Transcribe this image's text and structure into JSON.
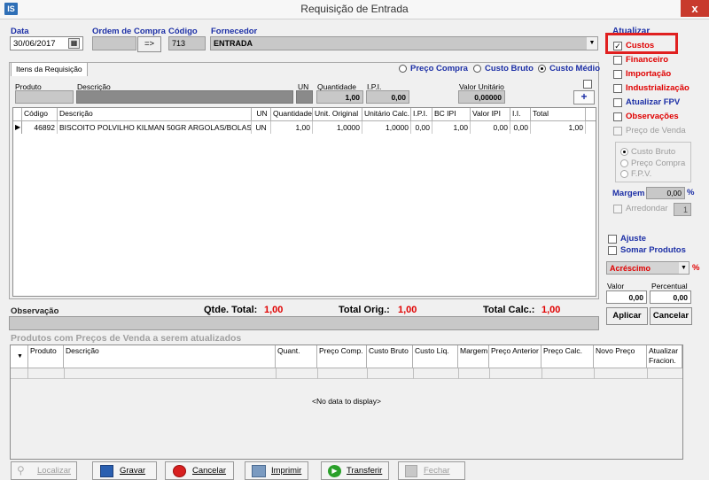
{
  "window": {
    "title": "Requisição de Entrada",
    "app_icon": "IS",
    "close": "x"
  },
  "header": {
    "data_label": "Data",
    "data_value": "30/06/2017",
    "ordem_label": "Ordem de Compra",
    "ordem_value": "",
    "ordem_btn": "=>",
    "codigo_label": "Código",
    "codigo_value": "713",
    "fornecedor_label": "Fornecedor",
    "fornecedor_value": "ENTRADA"
  },
  "tab": {
    "label": "Itens da Requisição"
  },
  "price_mode": {
    "options": [
      "Preço Compra",
      "Custo Bruto",
      "Custo Médio"
    ],
    "selected": "Custo Médio"
  },
  "item_entry": {
    "produto_label": "Produto",
    "descricao_label": "Descrição",
    "un_label": "UN",
    "quantidade_label": "Quantidade",
    "quantidade_value": "1,00",
    "ipi_label": "I.P.I.",
    "ipi_value": "0,00",
    "valor_label": "Valor Unitário",
    "valor_value": "0,00000",
    "add_btn": "+"
  },
  "items_table": {
    "columns": [
      "Código",
      "Descrição",
      "UN",
      "Quantidade",
      "Unit. Original",
      "Unitário Calc.",
      "I.P.I.",
      "BC IPI",
      "Valor IPI",
      "I.I.",
      "Total"
    ],
    "rows": [
      [
        "46892",
        "BISCOITO POLVILHO KILMAN 50GR ARGOLAS/BOLAS",
        "UN",
        "1,00",
        "1,0000",
        "1,0000",
        "0,00",
        "1,00",
        "0,00",
        "0,00",
        "1,00"
      ]
    ]
  },
  "observacao": {
    "label": "Observação"
  },
  "totals": {
    "qtde_label": "Qtde. Total:",
    "qtde_value": "1,00",
    "orig_label": "Total Orig.:",
    "orig_value": "1,00",
    "calc_label": "Total Calc.:",
    "calc_value": "1,00"
  },
  "produtos_precos": {
    "title": "Produtos com Preços de Venda a serem atualizados",
    "columns": [
      "Produto",
      "Descrição",
      "Quant.",
      "Preço Comp.",
      "Custo Bruto",
      "Custo Líq.",
      "Margem",
      "Preço Anterior",
      "Preço Calc.",
      "Novo Preço",
      "Atualizar Fracion."
    ],
    "empty": "<No data to display>"
  },
  "atualizar": {
    "title": "Atualizar",
    "options": [
      {
        "label": "Custos",
        "checked": true,
        "enabled": true
      },
      {
        "label": "Financeiro",
        "checked": false,
        "enabled": true
      },
      {
        "label": "Importação",
        "checked": false,
        "enabled": true
      },
      {
        "label": "Industrialização",
        "checked": false,
        "enabled": true
      },
      {
        "label": "Atualizar FPV",
        "checked": false,
        "enabled": true
      },
      {
        "label": "Observações",
        "checked": false,
        "enabled": true
      },
      {
        "label": "Preço de Venda",
        "checked": false,
        "enabled": false
      }
    ],
    "preco_options": [
      "Custo Bruto",
      "Preço Compra",
      "F.P.V."
    ],
    "margem_label": "Margem",
    "margem_value": "0,00",
    "pct": "%",
    "arredondar_label": "Arredondar",
    "arredondar_value": "1",
    "ajuste_label": "Ajuste",
    "somar_label": "Somar Produtos",
    "tipo_value": "Acréscimo",
    "tipo_pct": "%",
    "valor_label": "Valor",
    "valor_value": "0,00",
    "percentual_label": "Percentual",
    "percentual_value": "0,00",
    "aplicar": "Aplicar",
    "cancelar": "Cancelar"
  },
  "toolbar": {
    "localizar": "Localizar",
    "gravar": "Gravar",
    "cancelar": "Cancelar",
    "imprimir": "Imprimir",
    "transferir": "Transferir",
    "fechar": "Fechar"
  },
  "colors": {
    "accent_blue": "#1c2fa6",
    "accent_red": "#e00000",
    "highlight_box": "#e02020"
  }
}
